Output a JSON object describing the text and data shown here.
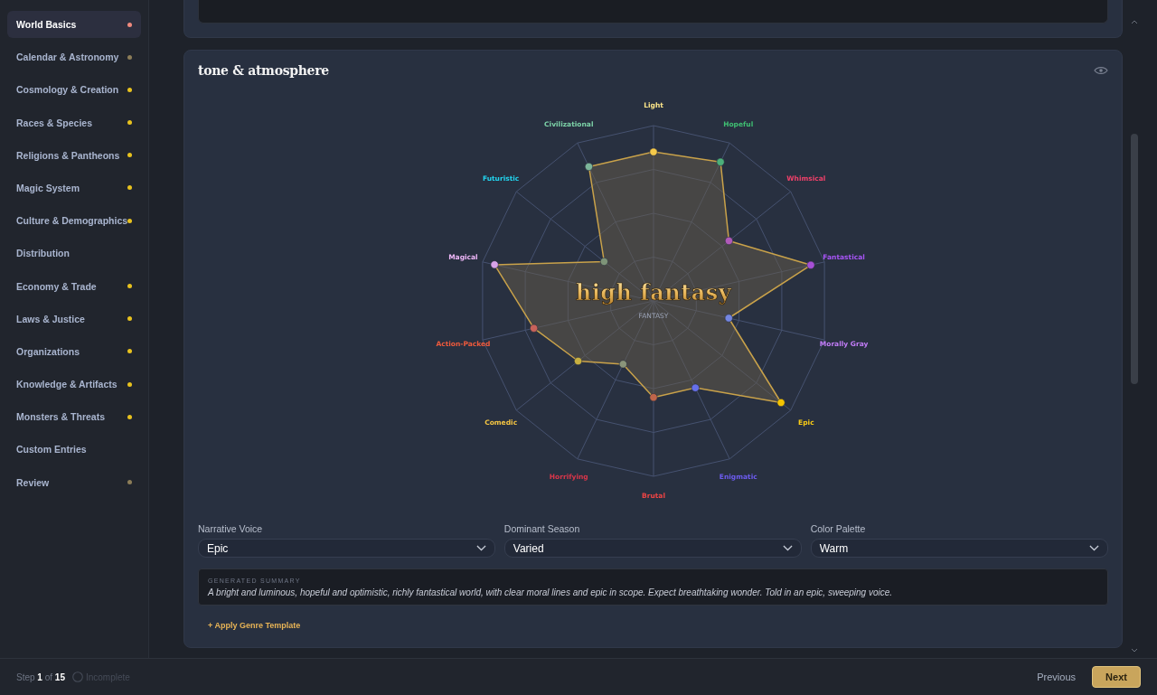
{
  "sidebar": {
    "items": [
      {
        "label": "World Basics",
        "selected": true,
        "color": "#f08a7e"
      },
      {
        "label": "Calendar & Astronomy",
        "selected": false,
        "color": "#8c7d58"
      },
      {
        "label": "Cosmology & Creation",
        "selected": false,
        "color": "#e8c21e"
      },
      {
        "label": "Races & Species",
        "selected": false,
        "color": "#e8c21e"
      },
      {
        "label": "Religions & Pantheons",
        "selected": false,
        "color": "#e8c21e"
      },
      {
        "label": "Magic System",
        "selected": false,
        "color": "#e8c21e"
      },
      {
        "label": "Culture & Demographics",
        "selected": false,
        "color": "#e8c21e"
      },
      {
        "label": "Distribution",
        "selected": false
      },
      {
        "label": "Economy & Trade",
        "selected": false,
        "color": "#e8c21e"
      },
      {
        "label": "Laws & Justice",
        "selected": false,
        "color": "#e8c21e"
      },
      {
        "label": "Organizations",
        "selected": false,
        "color": "#e8c21e"
      },
      {
        "label": "Knowledge & Artifacts",
        "selected": false,
        "color": "#e8c21e"
      },
      {
        "label": "Monsters & Threats",
        "selected": false,
        "color": "#e8c21e"
      },
      {
        "label": "Custom Entries",
        "selected": false
      },
      {
        "label": "Review",
        "selected": false,
        "color": "#8c7d58"
      }
    ]
  },
  "tone": {
    "title": "tone & atmosphere",
    "genre_title": "high fantasy",
    "genre_label": "FANTASY",
    "axes": [
      {
        "label": "Light",
        "color": "#fde68a"
      },
      {
        "label": "Civilizational",
        "color": "#7dd3a8"
      },
      {
        "label": "Hopeful",
        "color": "#3fbf72"
      },
      {
        "label": "Futuristic",
        "color": "#22d3ee"
      },
      {
        "label": "Whimsical",
        "color": "#f0406a"
      },
      {
        "label": "Magical",
        "color": "#f0b8fa"
      },
      {
        "label": "Fantastical",
        "color": "#a855f7"
      },
      {
        "label": "Action-Packed",
        "color": "#ef5a3c"
      },
      {
        "label": "Morally Gray",
        "color": "#c27cf7"
      },
      {
        "label": "Comedic",
        "color": "#f5c542"
      },
      {
        "label": "Epic",
        "color": "#facc15"
      },
      {
        "label": "Horrifying",
        "color": "#d9364a"
      },
      {
        "label": "Enigmatic",
        "color": "#6d5cf0"
      },
      {
        "label": "Brutal",
        "color": "#ef4444"
      }
    ]
  },
  "fields": [
    {
      "label": "Narrative Voice",
      "value": "Epic"
    },
    {
      "label": "Dominant Season",
      "value": "Varied"
    },
    {
      "label": "Color Palette",
      "value": "Warm"
    }
  ],
  "summary": {
    "heading": "GENERATED SUMMARY",
    "text": "A bright and luminous, hopeful and optimistic, richly fantastical world, with clear moral lines and epic in scope. Expect breathtaking wonder. Told in an epic, sweeping voice."
  },
  "apply_template": "+ Apply Genre Template",
  "footer": {
    "step": "Step **1** of **15**",
    "status": {
      "label": "Incomplete",
      "complete": false
    },
    "buttons": [
      {
        "label": "Previous",
        "kind": "secondary"
      },
      {
        "label": "Next",
        "kind": "primary"
      }
    ]
  }
}
